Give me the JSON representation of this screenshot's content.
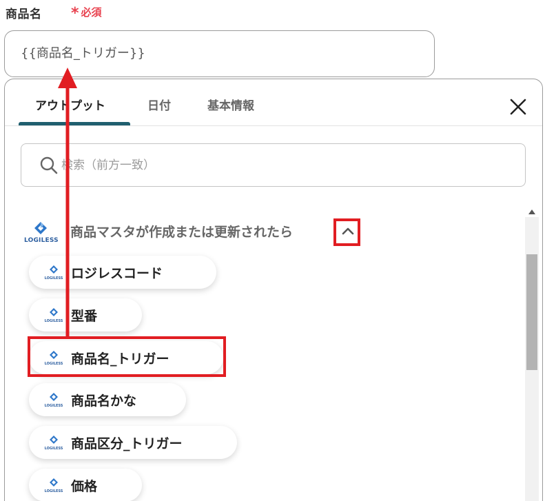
{
  "field": {
    "label": "商品名",
    "required_label": "必須",
    "value": "{{商品名_トリガー}}"
  },
  "tabs": [
    {
      "label": "アウトプット",
      "active": true
    },
    {
      "label": "日付",
      "active": false
    },
    {
      "label": "基本情報",
      "active": false
    }
  ],
  "search": {
    "placeholder": "検索（前方一致）"
  },
  "section": {
    "logo_text": "LOGILESS",
    "title": "商品マスタが作成または更新されたら"
  },
  "chip_logo_text": "LOGILESS",
  "items": [
    {
      "label": "ロジレスコード"
    },
    {
      "label": "型番"
    },
    {
      "label": "商品名_トリガー",
      "highlighted": true
    },
    {
      "label": "商品名かな"
    },
    {
      "label": "商品区分_トリガー"
    },
    {
      "label": "価格"
    }
  ],
  "colors": {
    "required_red": "#e8424f",
    "tab_underline": "#1f5f6f",
    "annotation_red": "#e11d22",
    "logo_blue": "#2d77c9"
  },
  "icons": {
    "close": "close-icon",
    "search": "search-icon",
    "collapse": "chevron-up-icon",
    "logo": "logiless-logo",
    "scroll_up": "scroll-up-arrow-icon"
  }
}
